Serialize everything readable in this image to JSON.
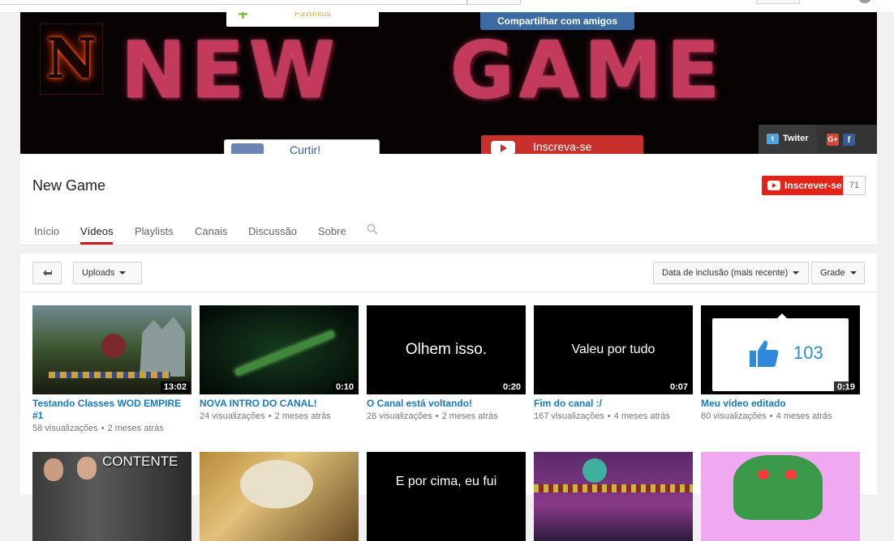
{
  "banner": {
    "favoritos": "Favoritos",
    "share": "Compartilhar com amigos",
    "logo_letter": "N",
    "word1": "NEW",
    "word2": "GAME",
    "twitter": "Twiter",
    "curtir": "Curtir!",
    "inscreva": "Inscreva-se"
  },
  "channel": {
    "name": "New Game",
    "subscribe": "Inscrever-se",
    "subscribers": "71"
  },
  "tabs": [
    "Início",
    "Vídeos",
    "Playlists",
    "Canais",
    "Discussão",
    "Sobre"
  ],
  "active_tab": "Vídeos",
  "toolbar": {
    "uploads": "Uploads",
    "sort": "Data de inclusão (mais recente)",
    "view": "Grade"
  },
  "videos": [
    {
      "title": "Testando Classes WOD EMPIRE #1",
      "views": "58 visualizações",
      "age": "2 meses atrás",
      "duration": "13:02",
      "thumb_text": ""
    },
    {
      "title": "NOVA INTRO DO CANAL!",
      "views": "24 visualizações",
      "age": "2 meses atrás",
      "duration": "0:10",
      "thumb_text": ""
    },
    {
      "title": "O Canal está voltando!",
      "views": "26 visualizações",
      "age": "2 meses atrás",
      "duration": "0:20",
      "thumb_text": "Olhem isso."
    },
    {
      "title": "Fim do canal :/",
      "views": "167 visualizações",
      "age": "4 meses atrás",
      "duration": "0:07",
      "thumb_text": "Valeu por tudo"
    },
    {
      "title": "Meu vídeo editado",
      "views": "60 visualizações",
      "age": "4 meses atrás",
      "duration": "0:19",
      "thumb_text": "103"
    }
  ],
  "videos_row2": [
    {
      "thumb_text": "CONTENTE"
    },
    {
      "thumb_text": ""
    },
    {
      "thumb_text": "E por cima, eu fui"
    },
    {
      "thumb_text": ""
    },
    {
      "thumb_text": ""
    }
  ],
  "colors": {
    "accent_red": "#e62117",
    "link_blue": "#167ac6",
    "tab_underline": "#cc181e"
  }
}
